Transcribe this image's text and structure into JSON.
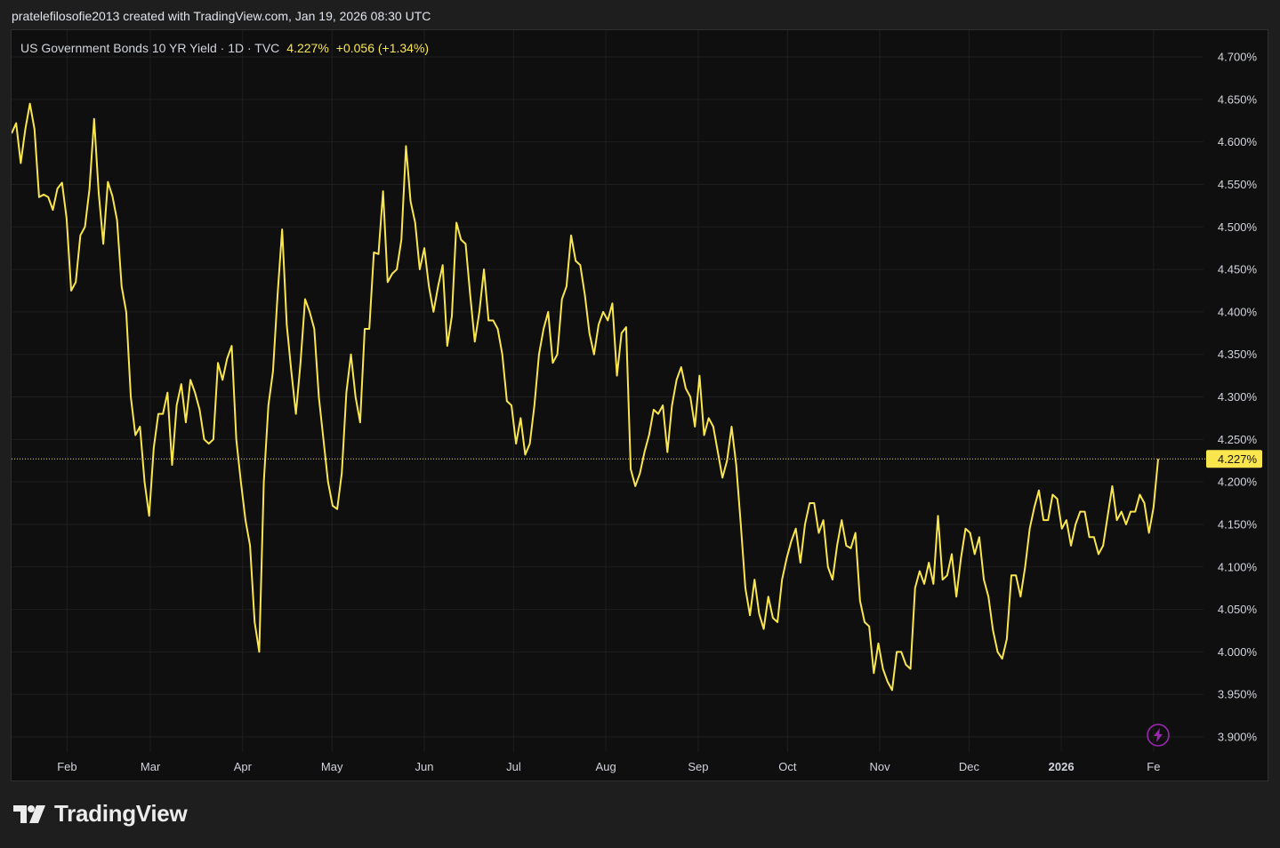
{
  "header": {
    "text": "pratelefilosofie2013 created with TradingView.com, Jan 19, 2026 08:30 UTC"
  },
  "legend": {
    "symbol": "US Government Bonds 10 YR Yield · 1D · TVC",
    "last": "4.227%",
    "change": "+0.056 (+1.34%)"
  },
  "footer": {
    "brand": "TradingView"
  },
  "colors": {
    "line": "#f9e64e",
    "background": "#0f0f0f",
    "grid": "#1f1f1f",
    "indicator": "#9c27b0"
  },
  "chart_data": {
    "type": "line",
    "series": [
      {
        "values": [
          4.61,
          4.622,
          4.575,
          4.615,
          4.645,
          4.615,
          4.535,
          4.538,
          4.535,
          4.52,
          4.545,
          4.552,
          4.51,
          4.425,
          4.435,
          4.49,
          4.5,
          4.545,
          4.627,
          4.54,
          4.48,
          4.553,
          4.536,
          4.508,
          4.43,
          4.4,
          4.3,
          4.255,
          4.265,
          4.2,
          4.16,
          4.24,
          4.28,
          4.28,
          4.305,
          4.22,
          4.29,
          4.315,
          4.27,
          4.32,
          4.305,
          4.285,
          4.25,
          4.245,
          4.25,
          4.34,
          4.32,
          4.345,
          4.36,
          4.25,
          4.2,
          4.155,
          4.125,
          4.035,
          4.0,
          4.2,
          4.29,
          4.33,
          4.42,
          4.497,
          4.385,
          4.33,
          4.28,
          4.34,
          4.415,
          4.4,
          4.38,
          4.3,
          4.25,
          4.2,
          4.172,
          4.168,
          4.21,
          4.305,
          4.35,
          4.3,
          4.27,
          4.38,
          4.38,
          4.47,
          4.468,
          4.542,
          4.435,
          4.445,
          4.45,
          4.485,
          4.595,
          4.53,
          4.505,
          4.45,
          4.475,
          4.43,
          4.4,
          4.43,
          4.455,
          4.36,
          4.395,
          4.505,
          4.485,
          4.48,
          4.42,
          4.365,
          4.4,
          4.45,
          4.39,
          4.39,
          4.38,
          4.35,
          4.295,
          4.29,
          4.245,
          4.275,
          4.232,
          4.245,
          4.29,
          4.35,
          4.38,
          4.4,
          4.34,
          4.35,
          4.415,
          4.43,
          4.49,
          4.46,
          4.455,
          4.42,
          4.375,
          4.35,
          4.385,
          4.4,
          4.39,
          4.41,
          4.325,
          4.375,
          4.382,
          4.215,
          4.195,
          4.21,
          4.235,
          4.255,
          4.285,
          4.28,
          4.29,
          4.235,
          4.29,
          4.32,
          4.335,
          4.31,
          4.3,
          4.265,
          4.325,
          4.255,
          4.275,
          4.265,
          4.235,
          4.205,
          4.225,
          4.265,
          4.22,
          4.15,
          4.075,
          4.043,
          4.085,
          4.045,
          4.027,
          4.065,
          4.04,
          4.035,
          4.085,
          4.11,
          4.13,
          4.145,
          4.105,
          4.15,
          4.175,
          4.175,
          4.14,
          4.155,
          4.1,
          4.085,
          4.125,
          4.155,
          4.125,
          4.122,
          4.14,
          4.06,
          4.035,
          4.03,
          3.975,
          4.01,
          3.98,
          3.965,
          3.955,
          4.0,
          4.0,
          3.985,
          3.98,
          4.075,
          4.095,
          4.08,
          4.105,
          4.08,
          4.16,
          4.085,
          4.09,
          4.115,
          4.065,
          4.11,
          4.145,
          4.14,
          4.115,
          4.135,
          4.085,
          4.065,
          4.025,
          4.0,
          3.992,
          4.015,
          4.09,
          4.09,
          4.065,
          4.1,
          4.145,
          4.17,
          4.19,
          4.155,
          4.155,
          4.185,
          4.18,
          4.145,
          4.155,
          4.125,
          4.15,
          4.165,
          4.165,
          4.135,
          4.135,
          4.115,
          4.125,
          4.16,
          4.195,
          4.155,
          4.165,
          4.15,
          4.165,
          4.165,
          4.185,
          4.175,
          4.14,
          4.17,
          4.227
        ]
      }
    ],
    "xticks": [
      {
        "label": "Feb",
        "bold": false,
        "pos": 0.0466
      },
      {
        "label": "Mar",
        "bold": false,
        "pos": 0.1165
      },
      {
        "label": "Apr",
        "bold": false,
        "pos": 0.1939
      },
      {
        "label": "May",
        "bold": false,
        "pos": 0.2688
      },
      {
        "label": "Jun",
        "bold": false,
        "pos": 0.3463
      },
      {
        "label": "Jul",
        "bold": false,
        "pos": 0.4212
      },
      {
        "label": "Aug",
        "bold": false,
        "pos": 0.4986
      },
      {
        "label": "Sep",
        "bold": false,
        "pos": 0.5761
      },
      {
        "label": "Oct",
        "bold": false,
        "pos": 0.651
      },
      {
        "label": "Nov",
        "bold": false,
        "pos": 0.7284
      },
      {
        "label": "Dec",
        "bold": false,
        "pos": 0.8033
      },
      {
        "label": "2026",
        "bold": true,
        "pos": 0.8807
      },
      {
        "label": "Fe",
        "bold": false,
        "pos": 0.9581
      }
    ],
    "yticks": [
      "4.700%",
      "4.650%",
      "4.600%",
      "4.550%",
      "4.500%",
      "4.450%",
      "4.400%",
      "4.350%",
      "4.300%",
      "4.250%",
      "4.200%",
      "4.150%",
      "4.100%",
      "4.050%",
      "4.000%",
      "3.950%",
      "3.900%"
    ],
    "ylim": [
      3.9,
      4.7
    ],
    "last_label": "4.227%",
    "grid": true
  }
}
